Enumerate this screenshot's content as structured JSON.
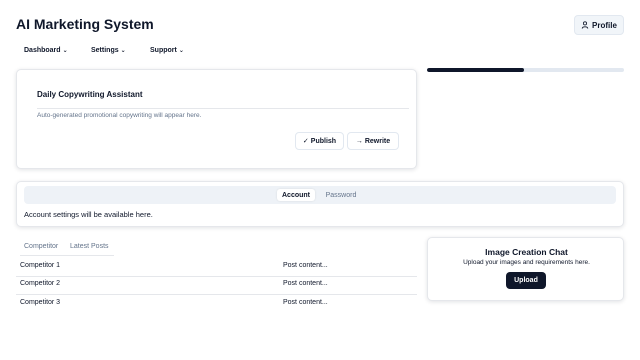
{
  "header": {
    "title": "AI Marketing System",
    "profile_label": "Profile"
  },
  "nav": {
    "items": [
      {
        "label": "Dashboard"
      },
      {
        "label": "Settings"
      },
      {
        "label": "Support"
      }
    ]
  },
  "copywriting": {
    "title": "Daily Copywriting Assistant",
    "description": "Auto-generated promotional copywriting will appear here.",
    "publish_label": "Publish",
    "rewrite_label": "Rewrite"
  },
  "progress": {
    "value_percent": 49
  },
  "settings": {
    "tabs": [
      {
        "label": "Account",
        "active": true
      },
      {
        "label": "Password",
        "active": false
      }
    ],
    "content": "Account settings will be available here."
  },
  "competitors": {
    "tabs": [
      {
        "label": "Competitor"
      },
      {
        "label": "Latest Posts"
      }
    ],
    "rows": [
      {
        "name": "Competitor 1",
        "post": "Post content..."
      },
      {
        "name": "Competitor 2",
        "post": "Post content..."
      },
      {
        "name": "Competitor 3",
        "post": "Post content..."
      }
    ]
  },
  "image_chat": {
    "title": "Image Creation Chat",
    "subtitle": "Upload your images and requirements here.",
    "upload_label": "Upload"
  },
  "colors": {
    "primary": "#0f172a",
    "muted_text": "#64748b",
    "border": "#e5e7eb",
    "track": "#e2e8f0",
    "tabs_bg": "#eef2f7"
  },
  "icons": {
    "profile": "user-icon",
    "nav_chevron": "chevron-down-icon",
    "publish": "check-icon",
    "rewrite": "arrow-right-icon"
  }
}
